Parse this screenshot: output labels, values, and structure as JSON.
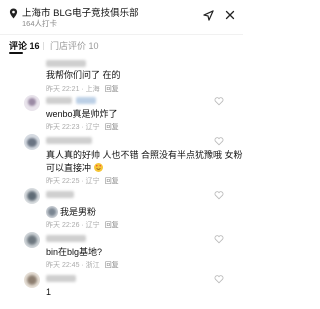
{
  "header": {
    "location_title": "上海市  BLG电子竞技俱乐部",
    "checkins": "164人打卡"
  },
  "tabs": [
    {
      "label": "评论 16"
    },
    {
      "label": "门店评价 10"
    }
  ],
  "comments": [
    {
      "text": "我帮你们问了  在的",
      "time": "昨天 22:21 · 上海",
      "reply": "回复"
    },
    {
      "text": "wenbo真是帅炸了",
      "time": "昨天 22:23 · 辽宁",
      "reply": "回复"
    },
    {
      "text_line1": "真人真的好帅  人也不错 合照没有半点犹豫哦  女粉",
      "text_line2": "可以直接冲",
      "time": "昨天 22:25 · 辽宁",
      "reply": "回复"
    },
    {
      "text": "我是男粉",
      "time": "昨天 22:26 · 辽宁",
      "reply": "回复"
    },
    {
      "text": "bin在blg基地?",
      "time": "昨天 22:45 · 浙江",
      "reply": "回复"
    },
    {
      "text": "1"
    }
  ],
  "colors": {
    "accent_tab": "#111111",
    "muted": "#aaaaaa"
  }
}
